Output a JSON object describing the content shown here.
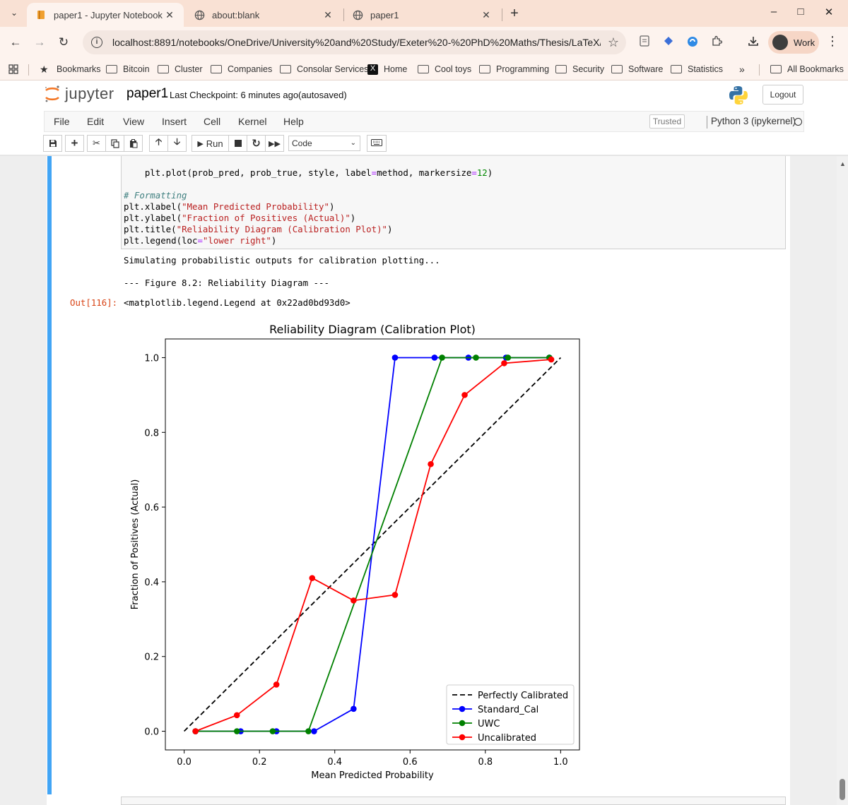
{
  "browser": {
    "tabs": [
      {
        "title": "paper1 - Jupyter Notebook",
        "active": true,
        "icon": "jupyter-book-icon"
      },
      {
        "title": "about:blank",
        "active": false,
        "icon": "globe-icon"
      },
      {
        "title": "paper1",
        "active": false,
        "icon": "globe-icon"
      }
    ],
    "url": "localhost:8891/notebooks/OneDrive/University%20and%20Study/Exeter%20-%20PhD%20Maths/Thesis/LaTeX/paper...",
    "profile": "Work",
    "bookmarks": [
      "Bookmarks",
      "Bitcoin",
      "Cluster",
      "Companies",
      "Consolar Services",
      "Home",
      "Cool toys",
      "Programming",
      "Security",
      "Software",
      "Statistics"
    ],
    "all_bookmarks": "All Bookmarks",
    "colors": {
      "tabstrip": "#f9e1d4",
      "toolbar": "#fdf3ee"
    }
  },
  "jupyter": {
    "logo_text": "jupyter",
    "notebook_name": "paper1",
    "checkpoint": "Last Checkpoint: 6 minutes ago",
    "autosave": "(autosaved)",
    "logout": "Logout",
    "menu": [
      "File",
      "Edit",
      "View",
      "Insert",
      "Cell",
      "Kernel",
      "Help"
    ],
    "trusted": "Trusted",
    "kernel": "Python 3 (ipykernel)",
    "run_label": "Run",
    "cell_type": "Code",
    "accent": "#42a5f5"
  },
  "cell": {
    "code_line_1_a": "    plt.plot(prob_pred, prob_true, style, label",
    "code_line_1_op": "=",
    "code_line_1_b": "method, markersize",
    "code_line_1_op2": "=",
    "code_line_1_num": "12",
    "code_line_1_c": ")",
    "comment": "# Formatting",
    "xlabel_call": "plt.xlabel(",
    "xlabel_str": "\"Mean Predicted Probability\"",
    "ylabel_call": "plt.ylabel(",
    "ylabel_str": "\"Fraction of Positives (Actual)\"",
    "title_call": "plt.title(",
    "title_str": "\"Reliability Diagram (Calibration Plot)\"",
    "legend_call": "plt.legend(loc",
    "legend_op": "=",
    "legend_str": "\"lower right\"",
    "close_paren": ")",
    "stdout_1": "Simulating probabilistic outputs for calibration plotting...",
    "stdout_2": "--- Figure 8.2: Reliability Diagram ---",
    "out_prompt": "Out[116]:",
    "out_repr": "<matplotlib.legend.Legend at 0x22ad0bd93d0>"
  },
  "chart_data": {
    "type": "line",
    "title": "Reliability Diagram (Calibration Plot)",
    "xlabel": "Mean Predicted Probability",
    "ylabel": "Fraction of Positives (Actual)",
    "xlim": [
      -0.05,
      1.05
    ],
    "ylim": [
      -0.05,
      1.05
    ],
    "xticks": [
      0.0,
      0.2,
      0.4,
      0.6,
      0.8,
      1.0
    ],
    "yticks": [
      0.0,
      0.2,
      0.4,
      0.6,
      0.8,
      1.0
    ],
    "tick_labels": [
      "0.0",
      "0.2",
      "0.4",
      "0.6",
      "0.8",
      "1.0"
    ],
    "legend_position": "lower right",
    "series": [
      {
        "name": "Perfectly Calibrated",
        "color": "#000000",
        "dashed": true,
        "markers": false,
        "x": [
          0.0,
          1.0
        ],
        "y": [
          0.0,
          1.0
        ]
      },
      {
        "name": "Standard_Cal",
        "color": "#0000ff",
        "dashed": false,
        "markers": true,
        "x": [
          0.03,
          0.15,
          0.245,
          0.345,
          0.45,
          0.56,
          0.665,
          0.755,
          0.855,
          0.97
        ],
        "y": [
          0.0,
          0.0,
          0.0,
          0.0,
          0.06,
          1.0,
          1.0,
          1.0,
          1.0,
          1.0
        ]
      },
      {
        "name": "UWC",
        "color": "#008000",
        "dashed": false,
        "markers": true,
        "x": [
          0.03,
          0.14,
          0.235,
          0.33,
          0.685,
          0.775,
          0.86,
          0.97
        ],
        "y": [
          0.0,
          0.0,
          0.0,
          0.0,
          1.0,
          1.0,
          1.0,
          1.0
        ]
      },
      {
        "name": "Uncalibrated",
        "color": "#ff0000",
        "dashed": false,
        "markers": true,
        "x": [
          0.03,
          0.14,
          0.245,
          0.34,
          0.45,
          0.56,
          0.655,
          0.745,
          0.85,
          0.975
        ],
        "y": [
          0.0,
          0.043,
          0.125,
          0.41,
          0.35,
          0.365,
          0.715,
          0.9,
          0.985,
          0.995
        ]
      }
    ]
  }
}
